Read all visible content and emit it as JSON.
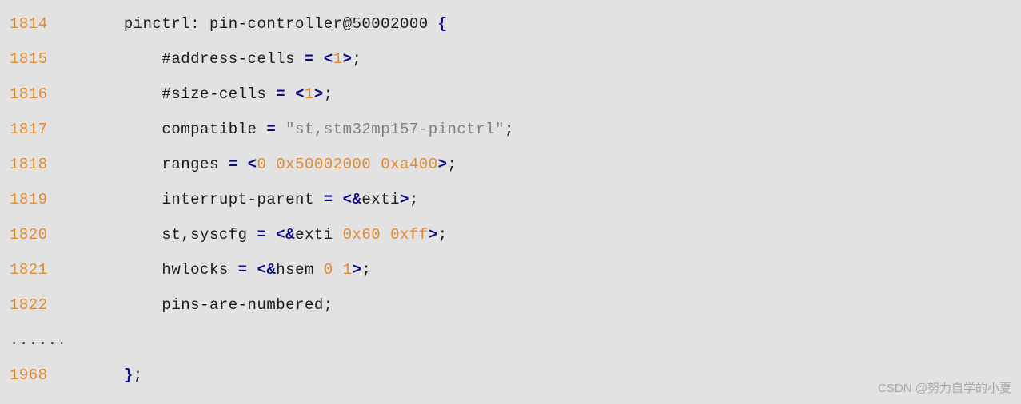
{
  "lines": {
    "l1814_no": "1814",
    "l1814_a": "        pinctrl: pin-controller@50002000 ",
    "l1814_b": "{",
    "l1815_no": "1815",
    "l1815_a": "            #address-cells ",
    "l1815_b": "=",
    "l1815_c": " ",
    "l1815_d": "<",
    "l1815_e": "1",
    "l1815_f": ">",
    "l1815_g": ";",
    "l1816_no": "1816",
    "l1816_a": "            #size-cells ",
    "l1816_b": "=",
    "l1816_c": " ",
    "l1816_d": "<",
    "l1816_e": "1",
    "l1816_f": ">",
    "l1816_g": ";",
    "l1817_no": "1817",
    "l1817_a": "            compatible ",
    "l1817_b": "=",
    "l1817_c": " ",
    "l1817_d": "\"st,stm32mp157-pinctrl\"",
    "l1817_e": ";",
    "l1818_no": "1818",
    "l1818_a": "            ranges ",
    "l1818_b": "=",
    "l1818_c": " ",
    "l1818_d": "<",
    "l1818_e": "0 0x50002000 0xa400",
    "l1818_f": ">",
    "l1818_g": ";",
    "l1819_no": "1819",
    "l1819_a": "            interrupt-parent ",
    "l1819_b": "=",
    "l1819_c": " ",
    "l1819_d": "<&",
    "l1819_e": "exti",
    "l1819_f": ">",
    "l1819_g": ";",
    "l1820_no": "1820",
    "l1820_a": "            st,syscfg ",
    "l1820_b": "=",
    "l1820_c": " ",
    "l1820_d": "<&",
    "l1820_e": "exti ",
    "l1820_f": "0x60 0xff",
    "l1820_g": ">",
    "l1820_h": ";",
    "l1821_no": "1821",
    "l1821_a": "            hwlocks ",
    "l1821_b": "=",
    "l1821_c": " ",
    "l1821_d": "<&",
    "l1821_e": "hsem ",
    "l1821_f": "0 1",
    "l1821_g": ">",
    "l1821_h": ";",
    "l1822_no": "1822",
    "l1822_a": "            pins-are-numbered;",
    "dots": "......",
    "l1968_no": "1968",
    "l1968_a": "        ",
    "l1968_b": "}",
    "l1968_c": ";"
  },
  "watermark": "CSDN @努力自学的小夏"
}
